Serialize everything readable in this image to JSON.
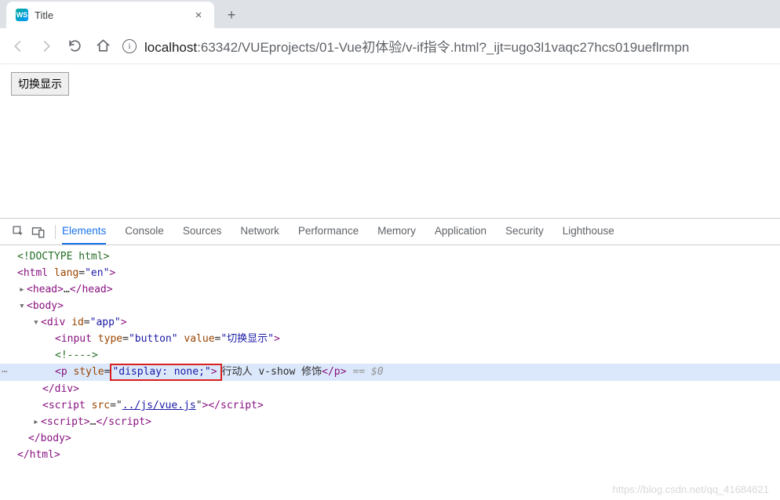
{
  "tab": {
    "favicon_label": "WS",
    "title": "Title",
    "close": "×",
    "new_tab": "+"
  },
  "address": {
    "host": "localhost",
    "path": ":63342/VUEprojects/01-Vue初体验/v-if指令.html?_ijt=ugo3l1vaqc27hcs019ueflrmpn"
  },
  "page": {
    "toggle_button": "切换显示"
  },
  "devtools": {
    "tabs": [
      "Elements",
      "Console",
      "Sources",
      "Network",
      "Performance",
      "Memory",
      "Application",
      "Security",
      "Lighthouse"
    ],
    "active_tab": "Elements"
  },
  "dom": {
    "doctype": "<!DOCTYPE html>",
    "html_open": {
      "tag": "html",
      "attr_name": "lang",
      "attr_val": "\"en\""
    },
    "head": {
      "open": "head",
      "ellipsis": "…",
      "close": "head"
    },
    "body_open": "body",
    "div_open": {
      "tag": "div",
      "attr_name": "id",
      "attr_val": "\"app\""
    },
    "input": {
      "tag": "input",
      "type_name": "type",
      "type_val": "\"button\"",
      "value_name": "value",
      "value_val": "\"切换显示\""
    },
    "comment": "<!---->",
    "p": {
      "tag": "p",
      "style_name": "style",
      "style_prefix": "=",
      "style_open": "\"",
      "style_rule": "display: none;",
      "style_close": "\"",
      "text": "行动人  v-show 修饰",
      "close": "p",
      "eq": "== $0"
    },
    "div_close": "div",
    "script1": {
      "tag": "script",
      "src_name": "src",
      "src_val": "../js/vue.js",
      "close": "script"
    },
    "script2": {
      "tag": "script",
      "ellipsis": "…",
      "close": "script"
    },
    "body_close": "body",
    "html_close": "html"
  },
  "watermark": "https://blog.csdn.net/qq_41684621"
}
